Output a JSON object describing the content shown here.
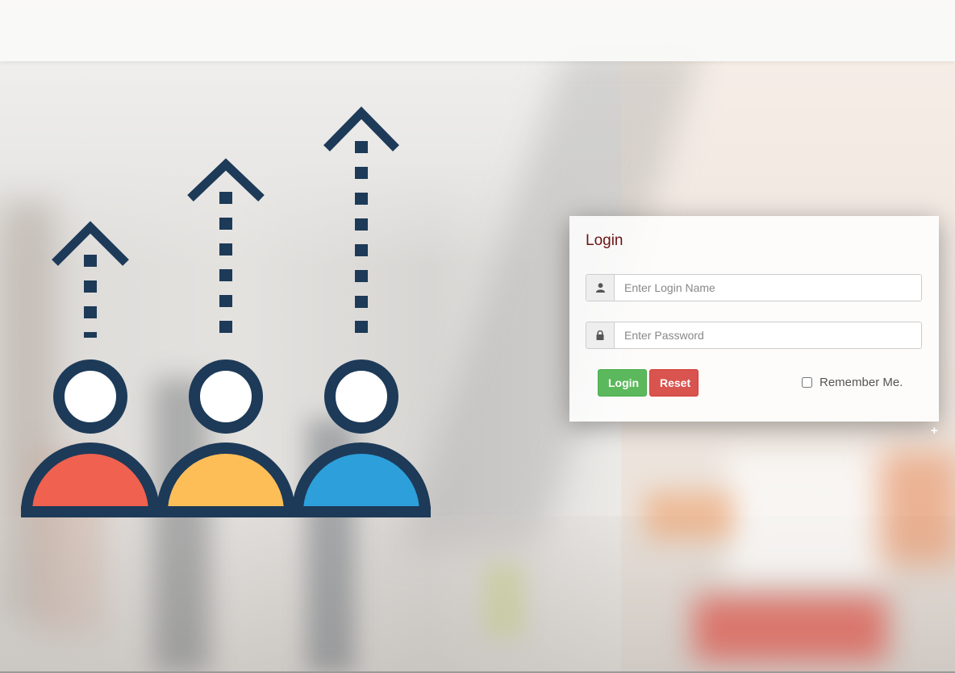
{
  "login": {
    "title": "Login",
    "username_placeholder": "Enter Login Name",
    "username_icon": "user-icon",
    "password_placeholder": "Enter Password",
    "password_icon": "lock-icon",
    "login_button": "Login",
    "reset_button": "Reset",
    "remember_label": "Remember Me."
  },
  "illustration": {
    "person_colors": [
      "#f0614f",
      "#fdbe58",
      "#2d9fdb"
    ],
    "outline_color": "#1d3a58"
  },
  "colors": {
    "login_button": "#5cb85c",
    "reset_button": "#d9534f",
    "title": "#6b1414"
  }
}
